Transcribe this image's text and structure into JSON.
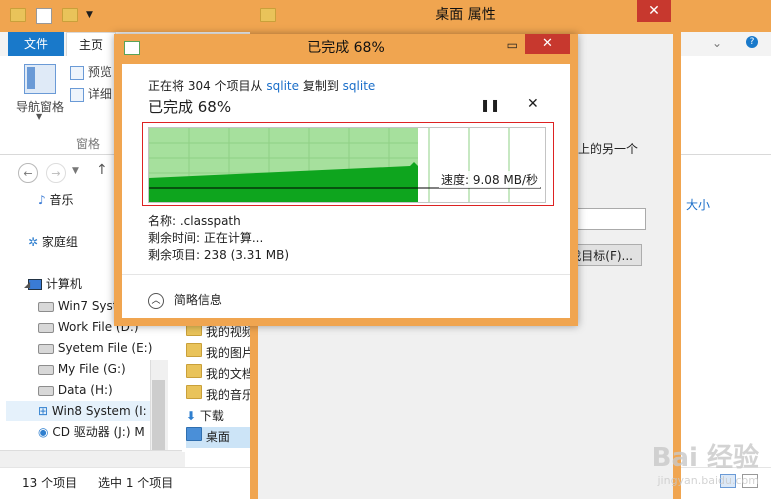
{
  "explorer": {
    "ribbon": {
      "tab_file": "文件",
      "tab_home": "主页",
      "nav_pane_label": "导航窗格",
      "preview_label": "预览",
      "details_label": "详细",
      "group_label": "窗格"
    },
    "nav_tree": [
      {
        "label": "音乐",
        "icon": "music-icon"
      },
      {
        "label": "家庭组",
        "icon": "homegroup-icon"
      },
      {
        "label": "计算机",
        "icon": "computer-icon"
      },
      {
        "label": "Win7 Syst",
        "icon": "drive-icon"
      },
      {
        "label": "Work File (D:)",
        "icon": "drive-icon"
      },
      {
        "label": "Syetem File (E:)",
        "icon": "drive-icon"
      },
      {
        "label": "My File (G:)",
        "icon": "drive-icon"
      },
      {
        "label": "Data (H:)",
        "icon": "drive-icon"
      },
      {
        "label": "Win8 System (I:",
        "icon": "windows-drive-icon"
      },
      {
        "label": "CD 驱动器 (J:) M",
        "icon": "cd-icon"
      }
    ],
    "files": [
      "我的视频",
      "我的图片",
      "我的文档",
      "我的音乐",
      "下载",
      "桌面"
    ],
    "status": {
      "item_count": "13 个项目",
      "selected": "选中 1 个项目"
    }
  },
  "properties": {
    "title": "桌面 属性",
    "partial_text_1": "止上的另一个",
    "partial_text_2": "大小",
    "find_target_button": "找目标(F)..."
  },
  "copy_dialog": {
    "title": "已完成 68%",
    "line_prefix": "正在将 304 个项目从",
    "source": "sqlite",
    "line_mid": "复制到",
    "dest": "sqlite",
    "progress_text": "已完成 68%",
    "progress_fraction": 0.68,
    "speed_text": "速度: 9.08 MB/秒",
    "name_line": "名称: .classpath",
    "time_line": "剩余时间: 正在计算...",
    "items_line": "剩余项目: 238 (3.31 MB)",
    "details_toggle": "简略信息",
    "pause_icon": "pause-icon",
    "cancel_icon": "close-icon"
  },
  "colors": {
    "title_bar": "#f0a550",
    "graph_done": "#a6e09d",
    "graph_fill": "#0ea51e",
    "close_red": "#c7382e",
    "link_blue": "#1a6ec9"
  },
  "watermark": {
    "brand": "Bai 经验",
    "url": "jingyan.baidu.com"
  }
}
